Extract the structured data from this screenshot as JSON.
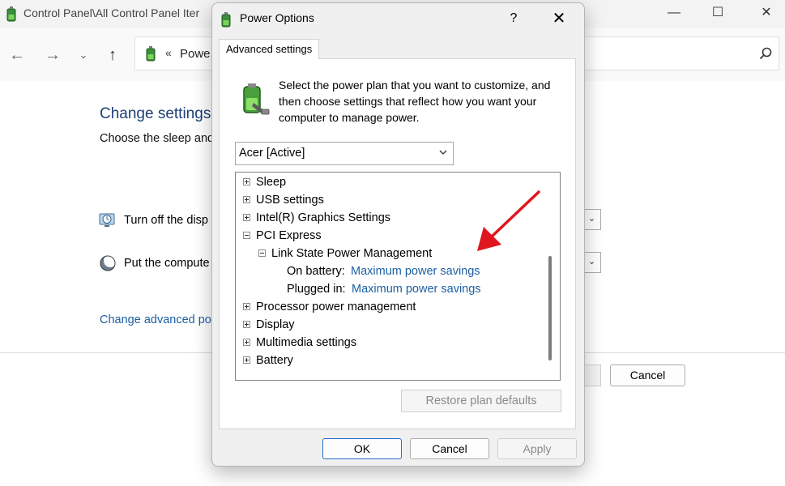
{
  "background_window": {
    "title": "Control Panel\\All Control Panel Iter",
    "breadcrumb_chevron": "«",
    "address_text": "Powe...",
    "heading": "Change settings",
    "subheading": "Choose the sleep and",
    "display_label": "Turn off the disp",
    "sleep_label": "Put the compute",
    "advanced_link": "Change advanced po",
    "cancel_label": "Cancel",
    "window_buttons": {
      "minimize": "—",
      "maximize": "☐",
      "close": "✕"
    },
    "nav": {
      "back": "←",
      "forward": "→",
      "recent": "⌄",
      "up": "↑"
    }
  },
  "dialog": {
    "title": "Power Options",
    "help_glyph": "?",
    "close_glyph": "✕",
    "tab_label": "Advanced settings",
    "intro_text": "Select the power plan that you want to customize, and then choose settings that reflect how you want your computer to manage power.",
    "plan_value": "Acer [Active]",
    "tree": {
      "sleep": "Sleep",
      "usb": "USB settings",
      "intel_graphics": "Intel(R) Graphics Settings",
      "pci_express": "PCI Express",
      "link_state": "Link State Power Management",
      "on_battery_label": "On battery:",
      "on_battery_value": "Maximum power savings",
      "plugged_in_label": "Plugged in:",
      "plugged_in_value": "Maximum power savings",
      "processor": "Processor power management",
      "display": "Display",
      "multimedia": "Multimedia settings",
      "battery": "Battery"
    },
    "restore_label": "Restore plan defaults",
    "ok_label": "OK",
    "cancel_label": "Cancel",
    "apply_label": "Apply"
  },
  "colors": {
    "link_blue": "#1c5fa3",
    "heading_blue": "#1e3f75",
    "annotation_arrow": "#e0161e"
  },
  "icons": [
    "power-options-icon",
    "search-icon",
    "display-icon",
    "sleep-icon",
    "battery-plug-icon",
    "chevron-down-icon",
    "expand-icon",
    "collapse-icon",
    "annotation-arrow"
  ]
}
